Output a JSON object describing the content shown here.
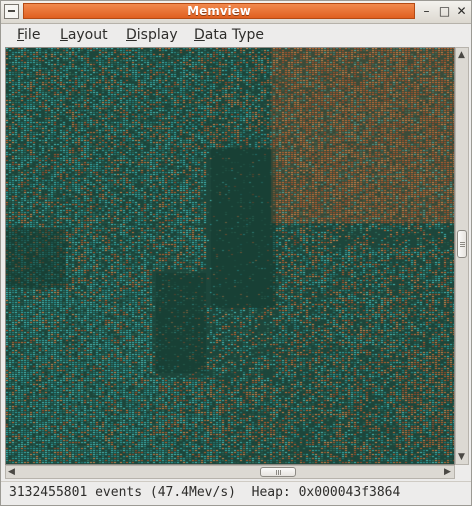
{
  "window": {
    "title": "Memview",
    "controls": {
      "minimize": "–",
      "maximize": "□",
      "close": "✕"
    }
  },
  "menu": {
    "items": [
      {
        "mnemonic": "F",
        "rest": "ile"
      },
      {
        "mnemonic": "L",
        "rest": "ayout"
      },
      {
        "mnemonic": "D",
        "rest": "isplay"
      },
      {
        "mnemonic": "D",
        "rest": "ata Type"
      }
    ]
  },
  "status": {
    "text": "3132455801 events (47.4Mev/s)  Heap: 0x000043f3864"
  },
  "colors": {
    "base_dark": "#1d463b",
    "teal": "#2ea3a6",
    "orange": "#c8622c",
    "title_accent": "#e8682a"
  }
}
